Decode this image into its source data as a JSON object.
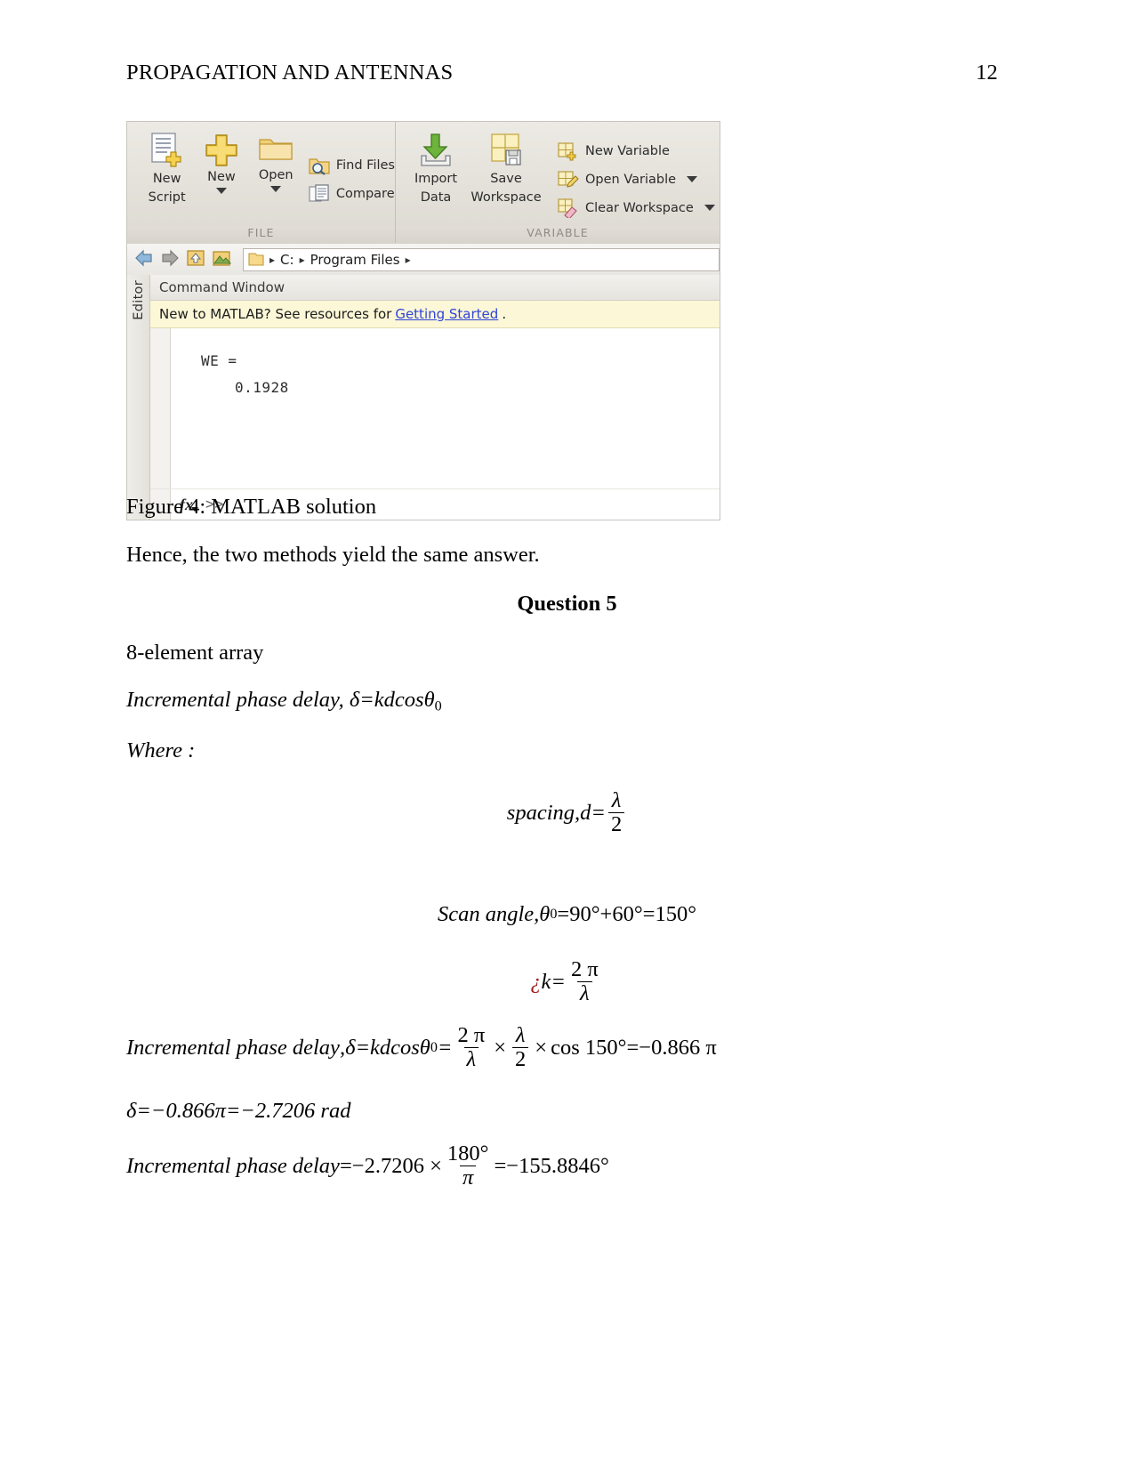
{
  "header": {
    "title": "PROPAGATION AND ANTENNAS",
    "page_number": "12"
  },
  "figure": {
    "caption": "Figure 4: MATLAB solution",
    "toolbar": {
      "groups": [
        {
          "label": "FILE",
          "buttons": [
            {
              "label_line1": "New",
              "label_line2": "Script",
              "icon": "new-script-icon",
              "has_caret": false
            },
            {
              "label_line1": "New",
              "label_line2": "",
              "icon": "plus-icon",
              "has_caret": true
            },
            {
              "label_line1": "Open",
              "label_line2": "",
              "icon": "folder-icon",
              "has_caret": true
            }
          ],
          "small_buttons": [
            {
              "label": "Find Files",
              "icon": "find-files-icon",
              "has_caret": false
            },
            {
              "label": "Compare",
              "icon": "compare-icon",
              "has_caret": false
            }
          ]
        },
        {
          "label": "VARIABLE",
          "buttons": [
            {
              "label_line1": "Import",
              "label_line2": "Data",
              "icon": "import-data-icon",
              "has_caret": false
            },
            {
              "label_line1": "Save",
              "label_line2": "Workspace",
              "icon": "save-workspace-icon",
              "has_caret": false
            }
          ],
          "small_buttons": [
            {
              "label": "New Variable",
              "icon": "new-variable-icon",
              "has_caret": false
            },
            {
              "label": "Open Variable",
              "icon": "open-variable-icon",
              "has_caret": true
            },
            {
              "label": "Clear Workspace",
              "icon": "clear-workspace-icon",
              "has_caret": true
            }
          ]
        }
      ]
    },
    "address_bar": {
      "crumbs": [
        "C:",
        "Program Files"
      ],
      "separator": "▸"
    },
    "editor_tab_label": "Editor",
    "command_window": {
      "title": "Command Window",
      "banner_prefix": "New to MATLAB? See resources for",
      "banner_link": "Getting Started",
      "banner_suffix": ".",
      "output_variable": "WE  =",
      "output_value": "0.1928",
      "prompt": ">>"
    }
  },
  "body": {
    "hence_line": "Hence, the two methods yield the same answer.",
    "question_heading": "Question 5",
    "array_line": "8-element array",
    "incremental_label": "Incremental phase delay",
    "where_label": "Where :",
    "spacing_label": "spacing",
    "scan_angle_label": "Scan angle",
    "delta_sym": "δ",
    "theta_sym": "θ",
    "lambda_sym": "λ",
    "pi_sym": "π",
    "kdcos": "kdcos",
    "eq1_rhs": "kdcos",
    "spacing_num": "λ",
    "spacing_den": "2",
    "scan_angle_value": "=90°+60°=150°",
    "k_marker": "¿",
    "k_label": "k",
    "k_num": "2 π",
    "k_den": "λ",
    "two_pi": "2 π",
    "lambda_den": "λ",
    "half_num": "λ",
    "half_den": "2",
    "times_sym": "×",
    "cos_term": "cos 150°",
    "eq_result": "=−0.866 π",
    "delta_rad_line": "δ=−0.866π=−2.7206 rad",
    "final_label": "Incremental phase delay",
    "final_value_prefix": "=−2.7206 ×",
    "final_num": "180°",
    "final_den": "π",
    "final_result": "=−155.8846°"
  }
}
